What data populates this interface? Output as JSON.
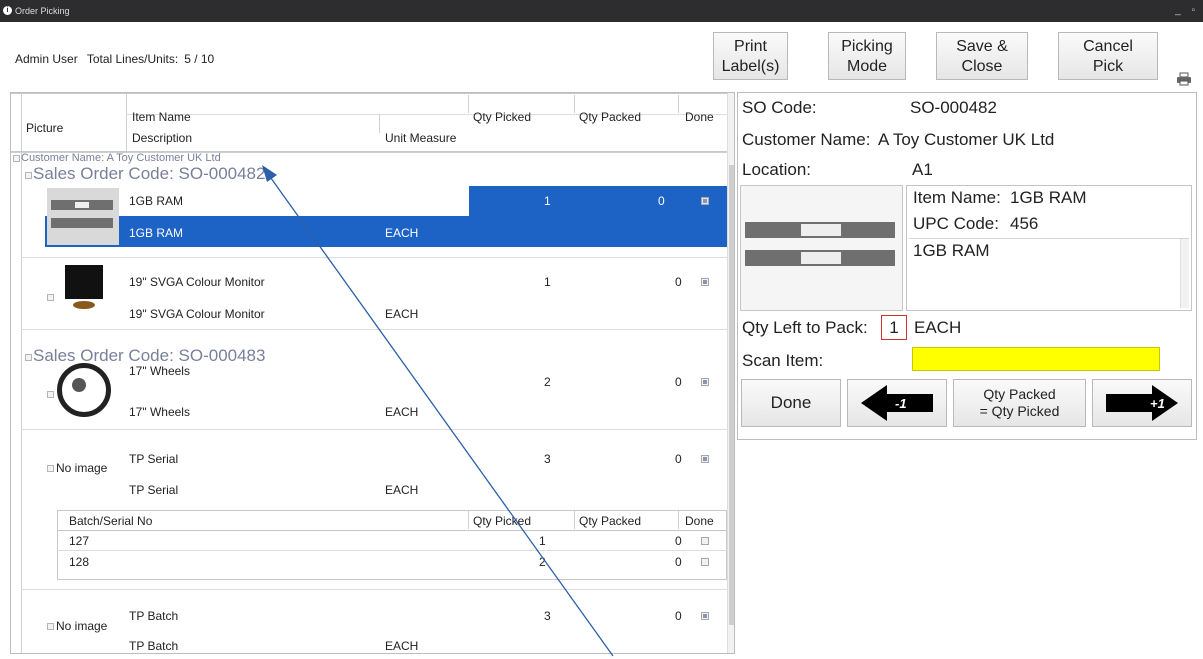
{
  "window": {
    "title": "Order Picking",
    "controls": "_ ▫"
  },
  "header": {
    "user": "Admin User",
    "totals_label": "Total Lines/Units:",
    "totals_value": "5 / 10"
  },
  "toolbar": {
    "print_line1": "Print",
    "print_line2": "Label(s)",
    "picking_line1": "Picking",
    "picking_line2": "Mode",
    "save_line1": "Save &",
    "save_line2": "Close",
    "cancel_line1": "Cancel",
    "cancel_line2": "Pick"
  },
  "grid": {
    "columns": {
      "picture": "Picture",
      "item_name": "Item Name",
      "description": "Description",
      "unit_measure": "Unit Measure",
      "qty_picked": "Qty Picked",
      "qty_packed": "Qty Packed",
      "done": "Done"
    },
    "customer_group": "Customer Name: A Toy Customer UK Ltd",
    "orders": [
      {
        "label": "Sales Order Code: SO-000482"
      },
      {
        "label": "Sales Order Code: SO-000483"
      }
    ],
    "rows": [
      {
        "name": "1GB RAM",
        "description": "1GB RAM",
        "unit": "EACH",
        "picked": "1",
        "packed": "0",
        "done": true,
        "picture": "ram-image",
        "selected": true
      },
      {
        "name": "19\" SVGA Colour Monitor",
        "description": "19\" SVGA Colour Monitor",
        "unit": "EACH",
        "picked": "1",
        "packed": "0",
        "done": true,
        "picture": "monitor-image"
      },
      {
        "name": "17\" Wheels",
        "description": "17\" Wheels",
        "unit": "EACH",
        "picked": "2",
        "packed": "0",
        "done": true,
        "picture": "wheel-image"
      },
      {
        "name": "TP Serial",
        "description": "TP Serial",
        "unit": "EACH",
        "picked": "3",
        "packed": "0",
        "done": true,
        "picture_text": "No image"
      },
      {
        "name": "TP Batch",
        "description": "TP Batch",
        "unit": "EACH",
        "picked": "3",
        "packed": "0",
        "done": true,
        "picture_text": "No image"
      }
    ],
    "serial_subgrid": {
      "columns": {
        "batch": "Batch/Serial No",
        "qty_picked": "Qty Picked",
        "qty_packed": "Qty Packed",
        "done": "Done"
      },
      "rows": [
        {
          "serial": "127",
          "picked": "1",
          "packed": "0",
          "done": false
        },
        {
          "serial": "128",
          "picked": "2",
          "packed": "0",
          "done": false
        }
      ]
    }
  },
  "details": {
    "so_code_label": "SO Code:",
    "so_code_value": "SO-000482",
    "customer_label": "Customer Name:",
    "customer_value": "A Toy Customer UK Ltd",
    "location_label": "Location:",
    "location_value": "A1",
    "item_name_label": "Item Name:",
    "item_name_value": "1GB RAM",
    "upc_label": "UPC Code:",
    "upc_value": "456",
    "description": "1GB RAM",
    "qty_left_label": "Qty Left to Pack:",
    "qty_left_value": "1",
    "qty_left_unit": "EACH",
    "scan_label": "Scan Item:",
    "scan_value": ""
  },
  "actions": {
    "done": "Done",
    "minus_one": "-1",
    "qty_packed_line1": "Qty Packed",
    "qty_packed_line2": "= Qty Picked",
    "plus_one": "+1"
  },
  "colors": {
    "selection": "#1d63c6",
    "scan_field": "#ffff00",
    "group_text": "#7a7f9a",
    "annotation_arrow": "#2b5fa8"
  }
}
